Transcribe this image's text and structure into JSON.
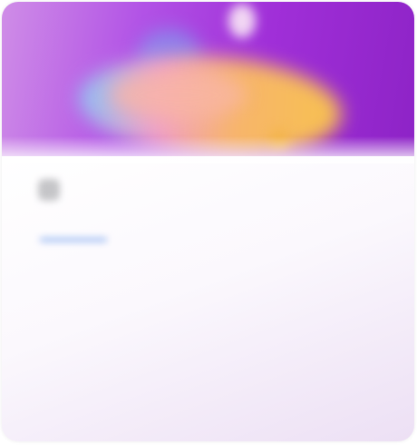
{
  "hero": {
    "artwork_name": "abstract-gradient-artwork",
    "colors": [
      "#cf8de7",
      "#a02fd8",
      "#f7b56b",
      "#8ec3f5"
    ]
  },
  "header": {
    "icon": "app-icon"
  },
  "tabs": [
    {
      "label": "",
      "active": true,
      "accent": "#8fb3f2"
    },
    {
      "label": "",
      "active": false
    }
  ],
  "main": {
    "title": "",
    "label": "",
    "value": "",
    "caption": "",
    "description": "",
    "link_text": ""
  }
}
